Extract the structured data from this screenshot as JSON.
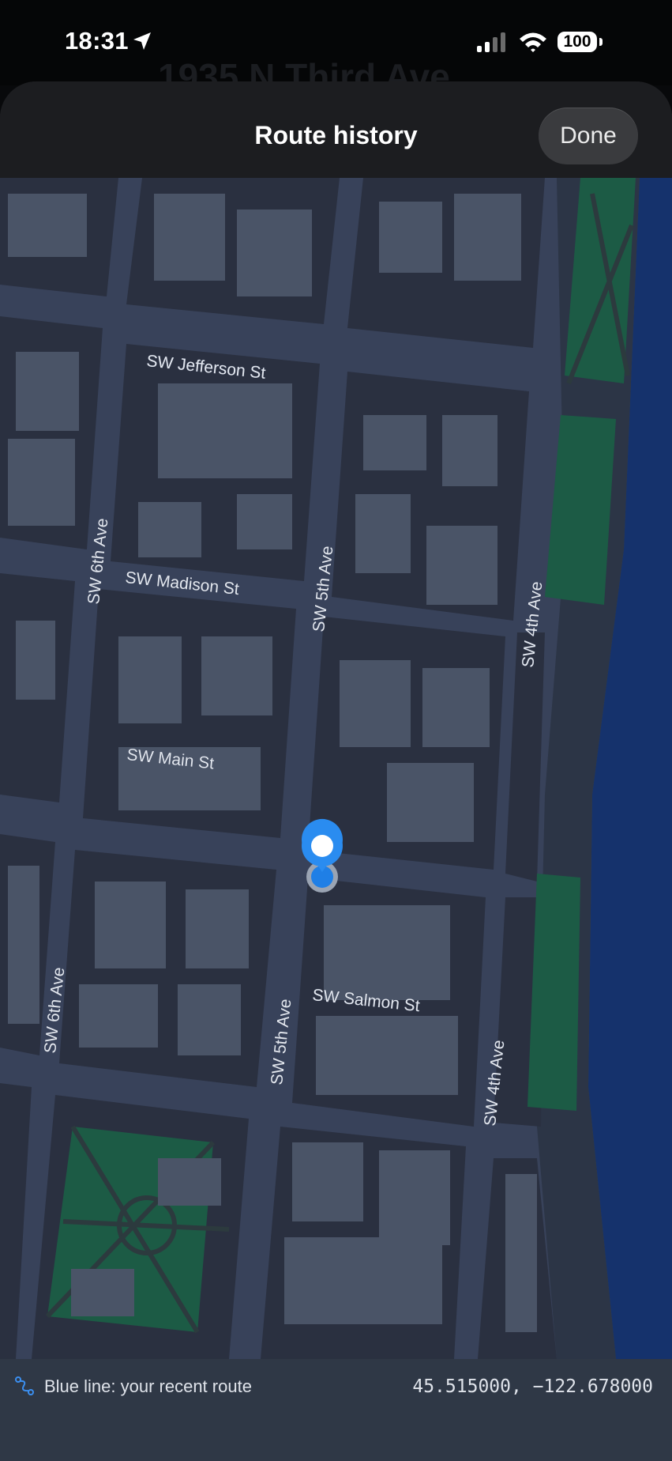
{
  "status_bar": {
    "time": "18:31",
    "battery": "100",
    "icons": [
      "location-arrow-icon",
      "cellular-signal-icon",
      "wifi-icon",
      "battery-icon"
    ]
  },
  "background": {
    "address_title": "1935 N Third Ave"
  },
  "sheet": {
    "title": "Route history",
    "done_label": "Done"
  },
  "map": {
    "street_labels": {
      "jefferson": "SW Jefferson St",
      "madison": "SW Madison St",
      "main": "SW Main St",
      "salmon": "SW Salmon St",
      "sixth_upper": "SW 6th Ave",
      "sixth_lower": "SW 6th Ave",
      "fifth_upper": "SW 5th Ave",
      "fifth_lower": "SW 5th Ave",
      "fourth_upper": "SW 4th Ave",
      "fourth_lower": "SW 4th Ave"
    },
    "colors": {
      "road": "#5a6479",
      "block": "#2a3040",
      "building": "#4a5467",
      "park": "#1c5b45",
      "water": "#15326c",
      "pin": "#2a8cf0"
    }
  },
  "info_bar": {
    "route_icon": "route-icon",
    "legend": "Blue line: your recent route",
    "coordinates": "45.515000, −122.678000"
  }
}
